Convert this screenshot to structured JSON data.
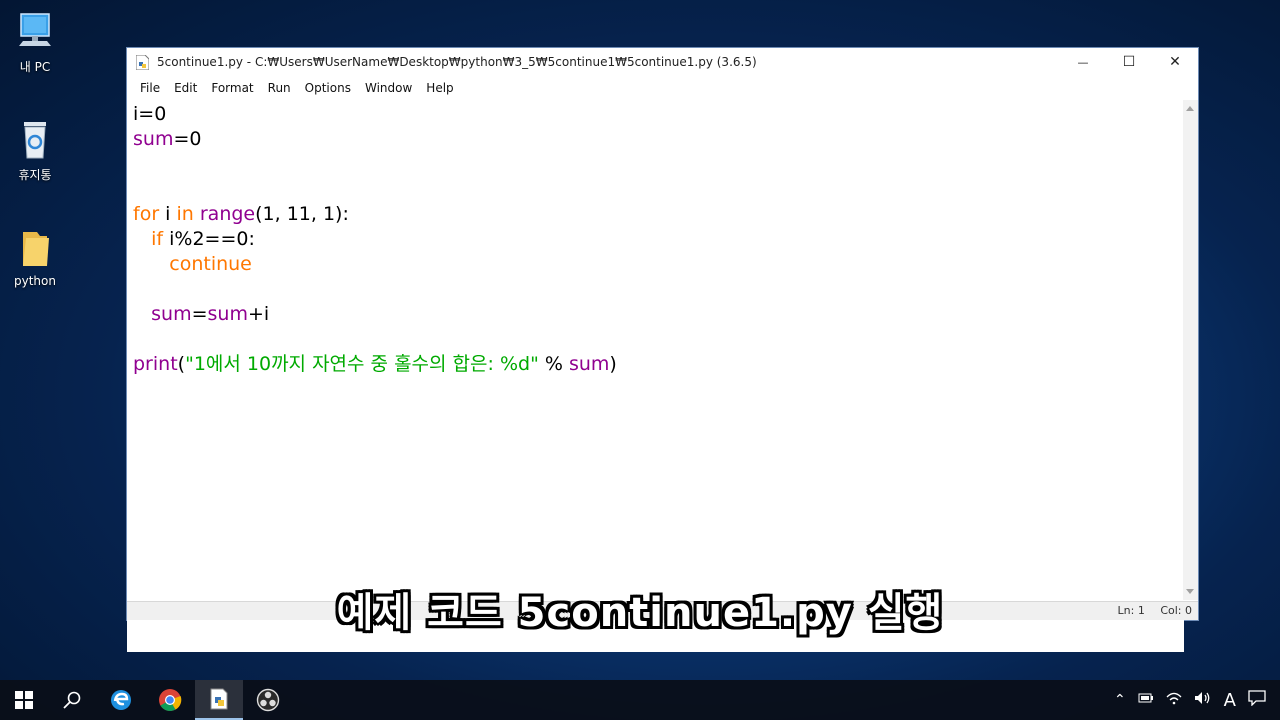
{
  "desktop": {
    "icons": [
      {
        "label": "내 PC",
        "icon": "computer-icon"
      },
      {
        "label": "휴지통",
        "icon": "recycle-bin-icon"
      },
      {
        "label": "python",
        "icon": "folder-icon"
      }
    ]
  },
  "window": {
    "title": "5continue1.py - C:₩Users₩UserName₩Desktop₩python₩3_5₩5continue1₩5continue1.py (3.6.5)",
    "controls": {
      "minimize": "—",
      "maximize": "☐",
      "close": "✕"
    },
    "menu": [
      "File",
      "Edit",
      "Format",
      "Run",
      "Options",
      "Window",
      "Help"
    ],
    "code": {
      "l1_var": "i",
      "l1_rest": "=0",
      "l2_var": "sum",
      "l2_rest": "=0",
      "l5_for": "for",
      "l5_mid": " i ",
      "l5_in": "in",
      "l5_range": "range",
      "l5_rest": "(1, 11, 1):",
      "l6_indent": "   ",
      "l6_if": "if",
      "l6_rest": " i%2==0:",
      "l7_indent": "      ",
      "l7_continue": "continue",
      "l9_indent": "   ",
      "l9_sum": "sum",
      "l9_eq": "=",
      "l9_sum2": "sum",
      "l9_rest": "+i",
      "l11_print": "print",
      "l11_open": "(",
      "l11_str": "\"1에서 10까지 자연수 중 홀수의 합은: %d\"",
      "l11_op": " % ",
      "l11_sum": "sum",
      "l11_close": ")"
    },
    "status": {
      "ln": "Ln: 1",
      "col": "Col: 0"
    }
  },
  "caption": "예제 코드 5continue1.py 실행",
  "taskbar": {
    "items": [
      "start-icon",
      "search-icon",
      "edge-icon",
      "chrome-icon",
      "idle-icon",
      "obs-icon"
    ],
    "tray": [
      "chevron-up-icon",
      "battery-icon",
      "wifi-icon",
      "volume-icon",
      "A",
      "notification-icon"
    ]
  }
}
